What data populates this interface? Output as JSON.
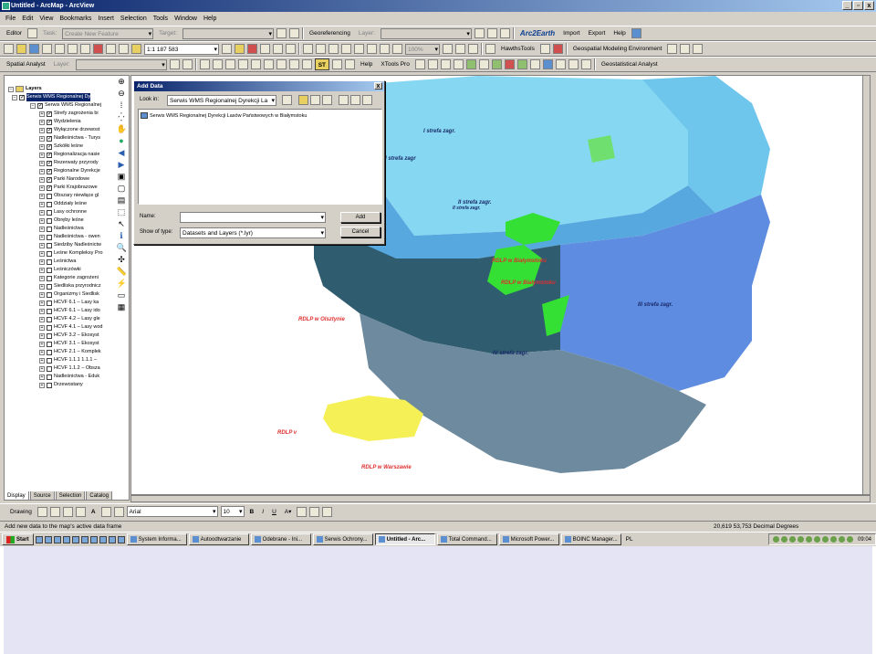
{
  "window": {
    "title": "Untitled - ArcMap - ArcView",
    "min": "_",
    "restore": "▫",
    "close": "x"
  },
  "menu": [
    "File",
    "Edit",
    "View",
    "Bookmarks",
    "Insert",
    "Selection",
    "Tools",
    "Window",
    "Help"
  ],
  "toolbar1": {
    "editor": "Editor",
    "task_label": "Task:",
    "task_value": "Create New Feature",
    "target_label": "Target:",
    "georef": "Georeferencing",
    "layer_label": "Layer:",
    "arc2earth": "Arc2Earth",
    "import": "Import",
    "export": "Export",
    "help": "Help"
  },
  "toolbar2": {
    "scale": "1:1 187 583",
    "zoom_pct": "100%",
    "hawths": "HawthsTools",
    "geomodel": "Geospatial Modeling Environment"
  },
  "toolbar3": {
    "spatial_analyst": "Spatial Analyst",
    "layer_label": "Layer:",
    "st_label": "ST",
    "help": "Help",
    "xtools": "XTools Pro",
    "geostat": "Geostatistical Analyst"
  },
  "toc": {
    "root": "Layers",
    "service": "Serwis WMS Regionalnej Dy",
    "sublayer": "Serwis WMS Regionalnej",
    "items": [
      "Strefy zagrożenia bi",
      "Wydzielenia",
      "Wyłączone drzewost",
      "Nadleśnictwa - Turys",
      "Szkółki leśne",
      "Regionalizacja nasie",
      "Rezerwaty przyrody",
      "Regionalne Dyrekcje",
      "Parki Narodowe",
      "Parki Krajobrazowe",
      "Obszary niewłące gl",
      "Oddziały leśne",
      "Lasy ochronne",
      "Obręby leśne",
      "Nadleśnictwa",
      "Nadleśnictwa - owen",
      "Siedziby Nadleśnictw",
      "Leśne Kompleksy Pro",
      "Leśnictwa",
      "Leśniczówki",
      "Kategorie zagrożeni",
      "Siedliska przyrodnicz",
      "Organizmy i Siedlisk",
      "HCVF 6.1 – Lasy ka",
      "HCVF 6.1 – Lasy ido",
      "HCVF 4.2 – Lasy gle",
      "HCVF 4.1 – Lasy wod",
      "HCVF 3.2 – Ekosyst",
      "HCVF 3.1 – Ekosyst",
      "HCVF 2.1 – Komplek",
      "HCVF 1.1.1 1.1.1 – ",
      "HCVF 1.1.2 – Obsza",
      "Nadleśnictwa - Eduk",
      "Drzewostany"
    ],
    "tabs": [
      "Display",
      "Source",
      "Selection",
      "Catalog"
    ]
  },
  "dialog": {
    "title": "Add Data",
    "close": "x",
    "look_in_label": "Look in:",
    "look_in_value": "Serwis WMS Regionalnej Dyrekcji La",
    "item": "Serwis WMS Regionalnej Dyrekcji Lasów Państwowych w Białymstoku",
    "name_label": "Name:",
    "name_value": "",
    "type_label": "Show of type:",
    "type_value": "Datasets and Layers (*.lyr)",
    "add": "Add",
    "cancel": "Cancel"
  },
  "map_labels": {
    "strefa1": "I strefa zagr.",
    "strefa2": "I strefa zagr",
    "strefa3": "II strefa zagr.",
    "strefa3b": "II strefa zagr.",
    "rdlp_bialystok1": "RDLP w Białymstoku",
    "rdlp_bialystok2": "RDLP w Białymstoku",
    "rdlp_olsztyn": "RDLP w Olsztynie",
    "strefa4": "IV strefa zagr.",
    "strefa5": "III strefa zagr.",
    "rdlp_partial": "RDLP v",
    "rdlp_warszawa": "RDLP w Warszawie"
  },
  "drawing": {
    "label": "Drawing",
    "font": "Arial",
    "size": "10",
    "bold": "B",
    "italic": "I",
    "underline": "U"
  },
  "status": {
    "message": "Add new data to the map's active data frame",
    "coords": "20,619  53,753 Decimal Degrees"
  },
  "taskbar": {
    "start": "Start",
    "tasks": [
      "System Informa...",
      "Autoodtwarzanie",
      "Odebrane - Ini...",
      "Serwis Ochrony...",
      "Untitled - Arc...",
      "Total Command...",
      "Microsoft Power...",
      "BOINC Manager..."
    ],
    "lang": "PL",
    "clock": "09:04"
  },
  "colors": {
    "map_light": "#7fd3f0",
    "map_mid": "#4ea8e0",
    "map_dark": "#2e5a6e",
    "map_blue": "#5e8ce0",
    "map_gray": "#6e8a9e",
    "green": "#34e034",
    "yellow": "#f4f056",
    "label_red": "#e03030"
  }
}
